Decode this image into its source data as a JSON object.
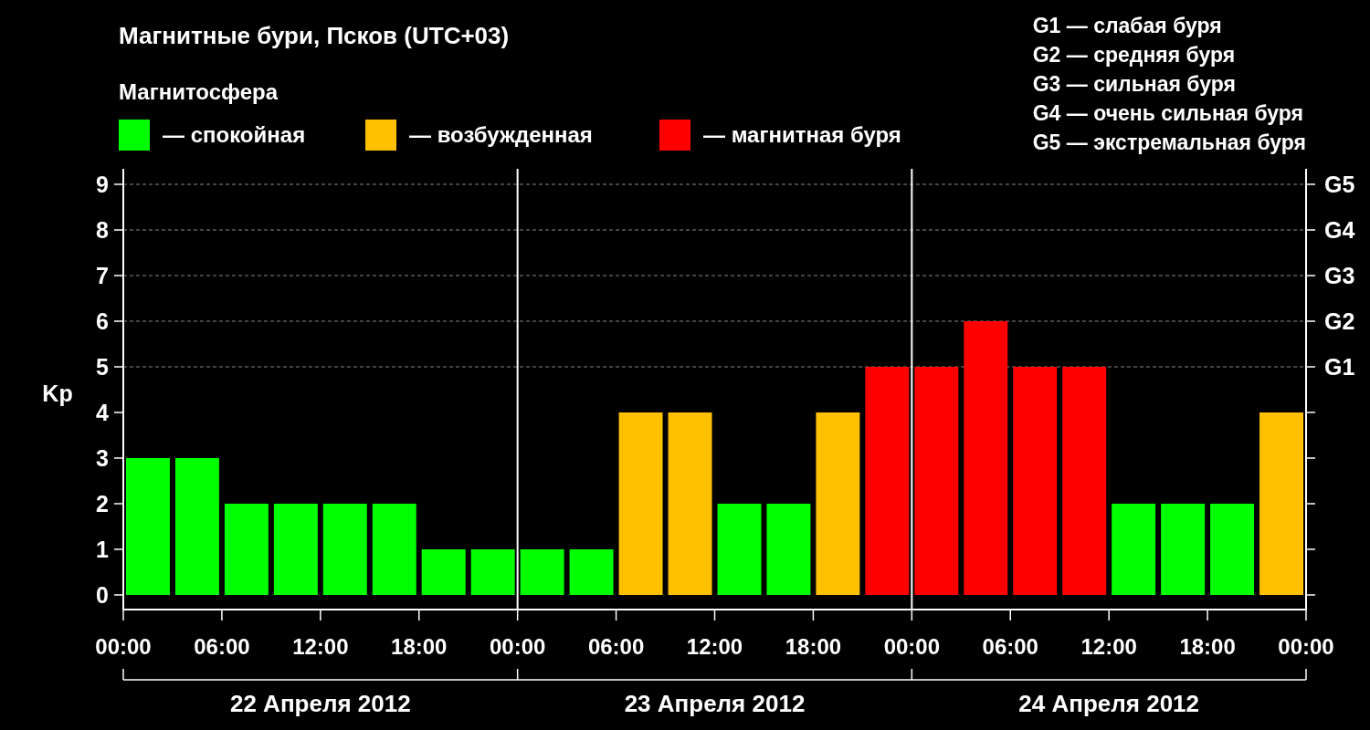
{
  "title": "Магнитные бури, Псков (UTC+03)",
  "magnetosphere": {
    "label": "Магнитосфера",
    "items": [
      {
        "label": "— спокойная",
        "color": "#00ff00"
      },
      {
        "label": "— возбужденная",
        "color": "#ffc000"
      },
      {
        "label": "— магнитная буря",
        "color": "#ff0000"
      }
    ]
  },
  "storm_scale": [
    "G1 — слабая буря",
    "G2 — средняя буря",
    "G3 — сильная буря",
    "G4 — очень сильная буря",
    "G5 — экстремальная буря"
  ],
  "chart": {
    "chart_data": {
      "type": "bar",
      "ylabel": "Kp",
      "grid": true,
      "categories": [
        null,
        null,
        null,
        null,
        null,
        null,
        null,
        null,
        null,
        null,
        null,
        null,
        null,
        null,
        null,
        null,
        null,
        null,
        null,
        null,
        null,
        null,
        null,
        null
      ],
      "series": [
        {
          "color": "#00ff00",
          "values": [
            3,
            3,
            2,
            2,
            2,
            2,
            1,
            1,
            1,
            1,
            null,
            null,
            2,
            2,
            null,
            null,
            null,
            null,
            null,
            null,
            2,
            2,
            2,
            null
          ]
        },
        {
          "color": "#ffc000",
          "values": [
            null,
            null,
            null,
            null,
            null,
            null,
            null,
            null,
            null,
            null,
            4,
            4,
            null,
            null,
            4,
            null,
            null,
            null,
            null,
            null,
            null,
            null,
            null,
            4
          ]
        },
        {
          "color": "#ff0000",
          "values": [
            null,
            null,
            null,
            null,
            null,
            null,
            null,
            null,
            null,
            null,
            null,
            null,
            null,
            null,
            null,
            5,
            5,
            6,
            5,
            5,
            null,
            null,
            null,
            null
          ]
        }
      ],
      "ylim": [
        -0.32,
        9.34
      ],
      "yticks": [
        0,
        1,
        2,
        3,
        4,
        5,
        6,
        7,
        8,
        9
      ]
    },
    "time_labels": [
      "00:00",
      "06:00",
      "12:00",
      "18:00",
      "00:00",
      "06:00",
      "12:00",
      "18:00",
      "00:00",
      "06:00",
      "12:00",
      "18:00",
      "00:00"
    ],
    "storm_ticks": [
      "G5",
      "G4",
      "G3",
      "G2",
      "G1"
    ],
    "day_labels": [
      "22 Апреля 2012",
      "23 Апреля 2012",
      "24 Апреля 2012"
    ]
  }
}
